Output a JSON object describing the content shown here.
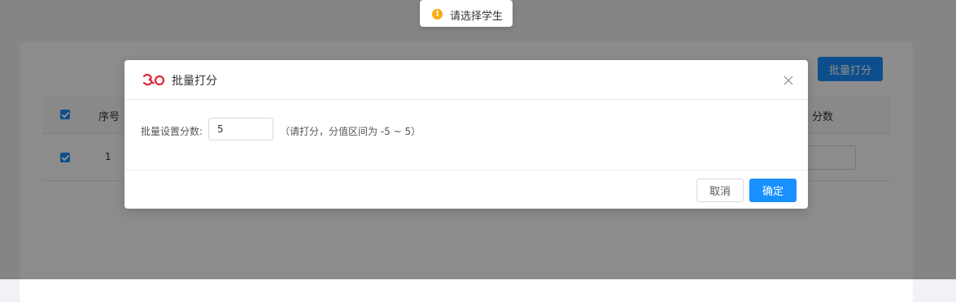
{
  "background": {
    "batch_button_label": "批量打分",
    "table": {
      "headers": {
        "seq": "序号",
        "score": "分数"
      },
      "rows": [
        {
          "seq": "1"
        }
      ]
    }
  },
  "modal": {
    "title": "批量打分",
    "field_label": "批量设置分数:",
    "score_value": "5",
    "hint": "（请打分，分值区间为 -5 ~ 5）",
    "cancel_label": "取消",
    "ok_label": "确定"
  },
  "toast": {
    "icon": "warning-icon",
    "text": "请选择学生"
  },
  "colors": {
    "primary": "#1890ff",
    "warning": "#faad14",
    "logo": "#e0273a"
  }
}
